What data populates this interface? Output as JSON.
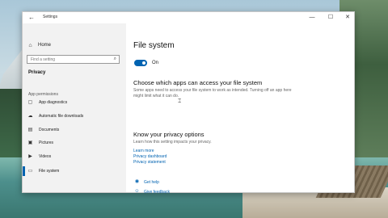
{
  "window": {
    "title": "Settings",
    "back_icon": "back-arrow-icon",
    "controls": {
      "minimize": "—",
      "maximize": "☐",
      "close": "✕"
    }
  },
  "sidebar": {
    "home_label": "Home",
    "search_placeholder": "Find a setting",
    "section_title": "Privacy",
    "group_label": "App permissions",
    "items": [
      {
        "label": "App diagnostics",
        "icon": "diagnostics-icon",
        "glyph": "▢"
      },
      {
        "label": "Automatic file downloads",
        "icon": "cloud-icon",
        "glyph": "☁"
      },
      {
        "label": "Documents",
        "icon": "document-icon",
        "glyph": "▤"
      },
      {
        "label": "Pictures",
        "icon": "picture-icon",
        "glyph": "▣"
      },
      {
        "label": "Videos",
        "icon": "video-icon",
        "glyph": "▶"
      },
      {
        "label": "File system",
        "icon": "file-system-icon",
        "glyph": "▭",
        "selected": true
      }
    ]
  },
  "content": {
    "title": "File system",
    "toggle_state": "On",
    "section1_heading": "Choose which apps can access your file system",
    "section1_body": "Some apps need to access your file system to work as intended. Turning off an app here might limit what it can do.",
    "section2_heading": "Know your privacy options",
    "section2_body": "Learn how this setting impacts your privacy.",
    "links": [
      "Learn more",
      "Privacy dashboard",
      "Privacy statement"
    ],
    "help": {
      "get_help": "Get help",
      "give_feedback": "Give feedback"
    }
  },
  "colors": {
    "accent": "#0063b1",
    "sidebar_bg": "#f2f2f2"
  }
}
